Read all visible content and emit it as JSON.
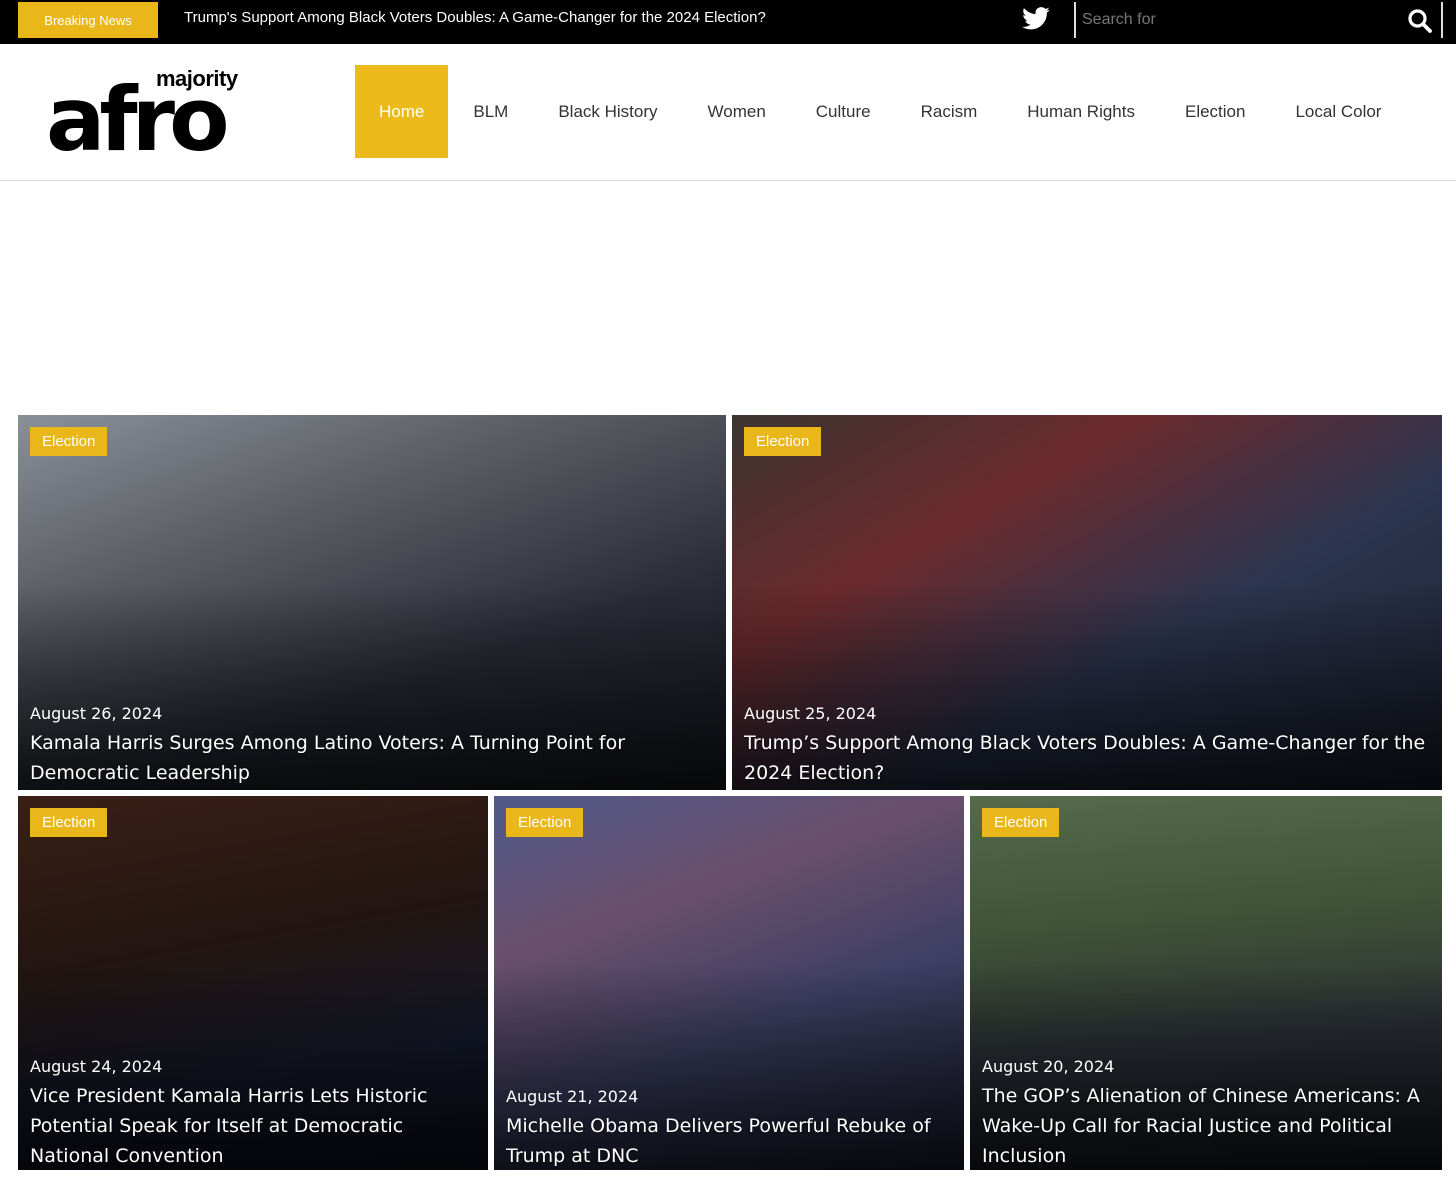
{
  "topbar": {
    "breaking_label": "Breaking News",
    "breaking_headline": "Trump's Support Among Black Voters Doubles: A Game-Changer for the 2024 Election?",
    "social_icon": "twitter-icon",
    "search_placeholder": "Search for",
    "search_icon": "search-icon"
  },
  "logo": {
    "small": "majority",
    "big": "afro"
  },
  "nav": {
    "items": [
      {
        "label": "Home",
        "active": true
      },
      {
        "label": "BLM"
      },
      {
        "label": "Black History"
      },
      {
        "label": "Women"
      },
      {
        "label": "Culture"
      },
      {
        "label": "Racism"
      },
      {
        "label": "Human Rights"
      },
      {
        "label": "Election"
      },
      {
        "label": "Local Color"
      }
    ]
  },
  "colors": {
    "accent": "#e9b719",
    "topbar": "#000000"
  },
  "articles": [
    {
      "category": "Election",
      "date": "August 26, 2024",
      "title": "Kamala Harris Surges Among Latino Voters: A Turning Point for Democratic Leadership"
    },
    {
      "category": "Election",
      "date": "August 25, 2024",
      "title": "Trump’s Support Among Black Voters Doubles: A Game-Changer for the 2024 Election?"
    },
    {
      "category": "Election",
      "date": "August 24, 2024",
      "title": "Vice President Kamala Harris Lets Historic Potential Speak for Itself at Democratic National Convention"
    },
    {
      "category": "Election",
      "date": "August 21, 2024",
      "title": "Michelle Obama Delivers Powerful Rebuke of Trump at DNC"
    },
    {
      "category": "Election",
      "date": "August 20, 2024",
      "title": "The GOP’s Alienation of Chinese Americans: A Wake-Up Call for Racial Justice and Political Inclusion"
    }
  ]
}
